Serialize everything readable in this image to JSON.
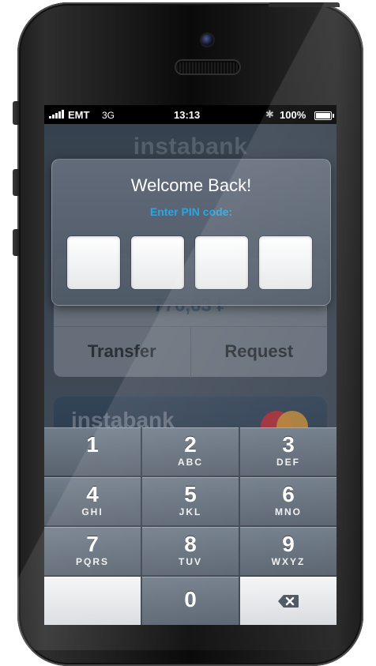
{
  "status_bar": {
    "carrier": "EMT",
    "network": "3G",
    "time": "13:13",
    "bluetooth_icon": "bluetooth-icon",
    "battery_percent": "100%",
    "battery_level": 1.0
  },
  "app": {
    "logo": "instabank",
    "balance": "776,63 ₣",
    "actions": [
      "Transfer",
      "Request"
    ],
    "card_logo": "instabank"
  },
  "pin_dialog": {
    "title": "Welcome Back!",
    "subtitle": "Enter PIN code:",
    "digits_entered": 0,
    "digits_total": 4
  },
  "keypad": {
    "keys": [
      {
        "num": "1",
        "letters": ""
      },
      {
        "num": "2",
        "letters": "ABC"
      },
      {
        "num": "3",
        "letters": "DEF"
      },
      {
        "num": "4",
        "letters": "GHI"
      },
      {
        "num": "5",
        "letters": "JKL"
      },
      {
        "num": "6",
        "letters": "MNO"
      },
      {
        "num": "7",
        "letters": "PQRS"
      },
      {
        "num": "8",
        "letters": "TUV"
      },
      {
        "num": "9",
        "letters": "WXYZ"
      },
      {
        "num": "0",
        "letters": ""
      }
    ],
    "delete_icon": "backspace-icon"
  },
  "colors": {
    "accent": "#2ba6e0",
    "key_dark": "#59636f",
    "key_light": "#e6e8ea"
  }
}
